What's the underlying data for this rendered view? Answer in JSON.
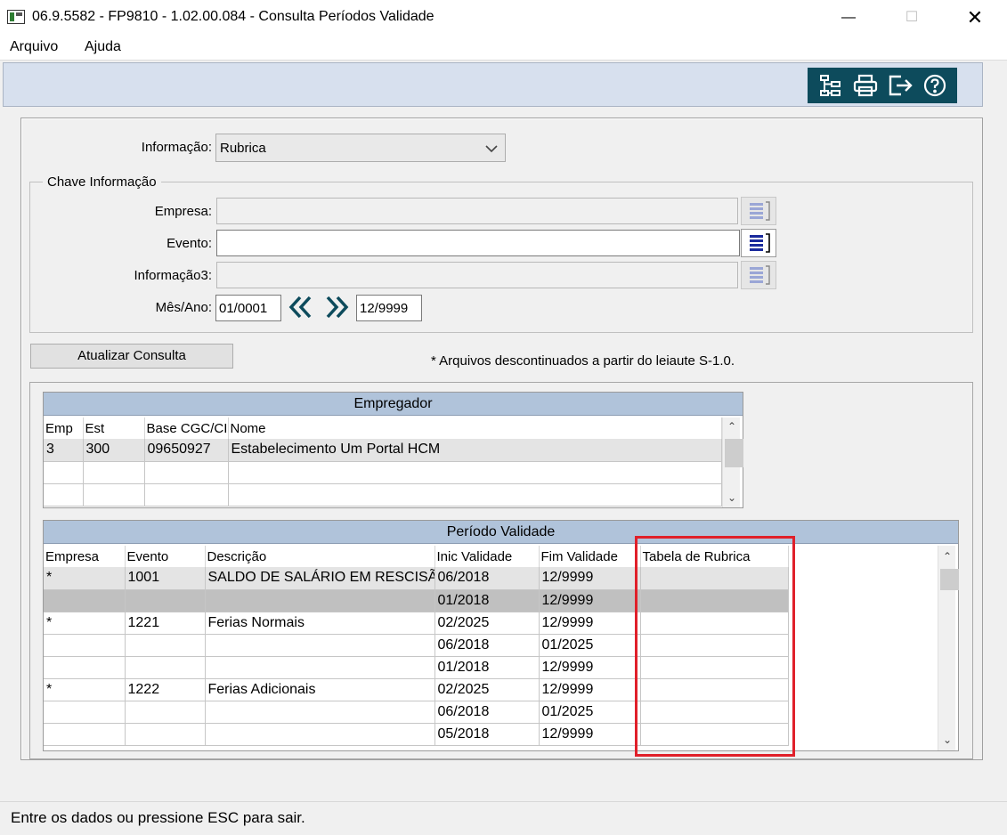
{
  "window": {
    "title": "06.9.5582 - FP9810 - 1.02.00.084 - Consulta Períodos Validade",
    "minimize": "—",
    "maximize": "☐",
    "close": "✕"
  },
  "menu": {
    "items": [
      "Arquivo",
      "Ajuda"
    ]
  },
  "toolbar": {
    "icons": [
      "tree-icon",
      "printer-icon",
      "exit-icon",
      "help-icon"
    ]
  },
  "form": {
    "informacao_label": "Informação:",
    "informacao_value": "Rubrica",
    "group_title": "Chave Informação",
    "empresa_label": "Empresa:",
    "empresa_value": "",
    "evento_label": "Evento:",
    "evento_value": "",
    "informacao3_label": "Informação3:",
    "informacao3_value": "",
    "mesano_label": "Mês/Ano:",
    "mesano_start": "01/0001",
    "mesano_end": "12/9999",
    "prev_symbol": "«",
    "next_symbol": "»",
    "refresh_button": "Atualizar Consulta",
    "note": "* Arquivos descontinuados a partir do leiaute S-1.0."
  },
  "empregador": {
    "title": "Empregador",
    "columns": [
      "Emp",
      "Est",
      "Base CGC/CI",
      "Nome"
    ],
    "rows": [
      [
        "3",
        "300",
        "09650927",
        "Estabelecimento Um Portal HCM"
      ],
      [
        "",
        "",
        "",
        ""
      ],
      [
        "",
        "",
        "",
        ""
      ]
    ]
  },
  "periodo": {
    "title": "Período Validade",
    "columns": [
      "Empresa",
      "Evento",
      "Descrição",
      "Inic Validade",
      "Fim Validade",
      "Tabela de Rubrica"
    ],
    "rows": [
      [
        "*",
        "1001",
        "SALDO DE SALÁRIO EM RESCISÃO",
        "06/2018",
        "12/9999",
        ""
      ],
      [
        "",
        "",
        "",
        "01/2018",
        "12/9999",
        ""
      ],
      [
        "*",
        "1221",
        "Ferias Normais",
        "02/2025",
        "12/9999",
        ""
      ],
      [
        "",
        "",
        "",
        "06/2018",
        "01/2025",
        ""
      ],
      [
        "",
        "",
        "",
        "01/2018",
        "12/9999",
        ""
      ],
      [
        "*",
        "1222",
        "Ferias Adicionais",
        "02/2025",
        "12/9999",
        ""
      ],
      [
        "",
        "",
        "",
        "06/2018",
        "01/2025",
        ""
      ],
      [
        "",
        "",
        "",
        "05/2018",
        "12/9999",
        ""
      ]
    ]
  },
  "status": {
    "text": "Entre os dados ou pressione ESC para sair."
  },
  "colors": {
    "accent": "#0d4b5c",
    "grid_header": "#b0c3da",
    "highlight": "#e0202a"
  }
}
